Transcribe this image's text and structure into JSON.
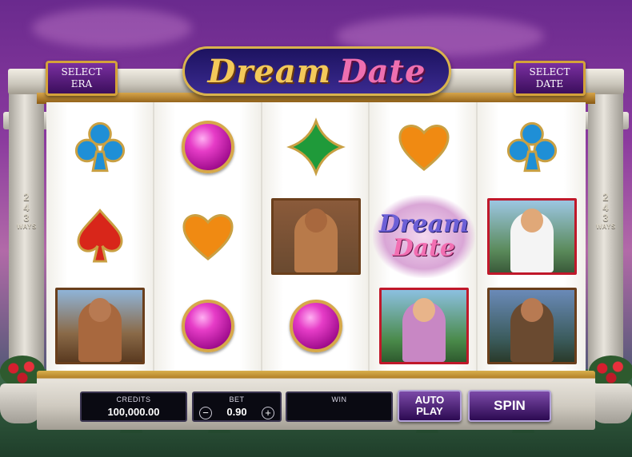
{
  "game": {
    "logo_word1": "Dream",
    "logo_word2": "Date"
  },
  "header": {
    "select_era_line1": "SELECT",
    "select_era_line2": "ERA",
    "select_date_line1": "SELECT",
    "select_date_line2": "DATE"
  },
  "ways": {
    "number": [
      "2",
      "4",
      "3"
    ],
    "word": "WAYS"
  },
  "reels": [
    [
      "blue-club",
      "red-spade",
      "pirate-portrait"
    ],
    [
      "pink-gem",
      "orange-heart",
      "pink-gem"
    ],
    [
      "green-diamond",
      "gladiator-portrait",
      "pink-gem"
    ],
    [
      "orange-heart",
      "dream-date-wild",
      "lady-portrait"
    ],
    [
      "blue-club",
      "modern-man-portrait",
      "warrior-portrait"
    ]
  ],
  "wild": {
    "word1": "Dream",
    "word2": "Date"
  },
  "controls": {
    "credits_label": "CREDITS",
    "credits_value": "100,000.00",
    "bet_label": "BET",
    "bet_value": "0.90",
    "bet_minus": "−",
    "bet_plus": "+",
    "win_label": "WIN",
    "win_value": "",
    "autoplay_line1": "AUTO",
    "autoplay_line2": "PLAY",
    "spin_label": "SPIN"
  },
  "colors": {
    "club_blue": "#1f8fd6",
    "spade_red": "#d8261a",
    "heart_orange": "#f08a12",
    "diamond_green": "#1f9a3a",
    "gem_pink": "#e63cc7",
    "frame_gold": "#d4a23a",
    "button_purple": "#4b1a78"
  }
}
